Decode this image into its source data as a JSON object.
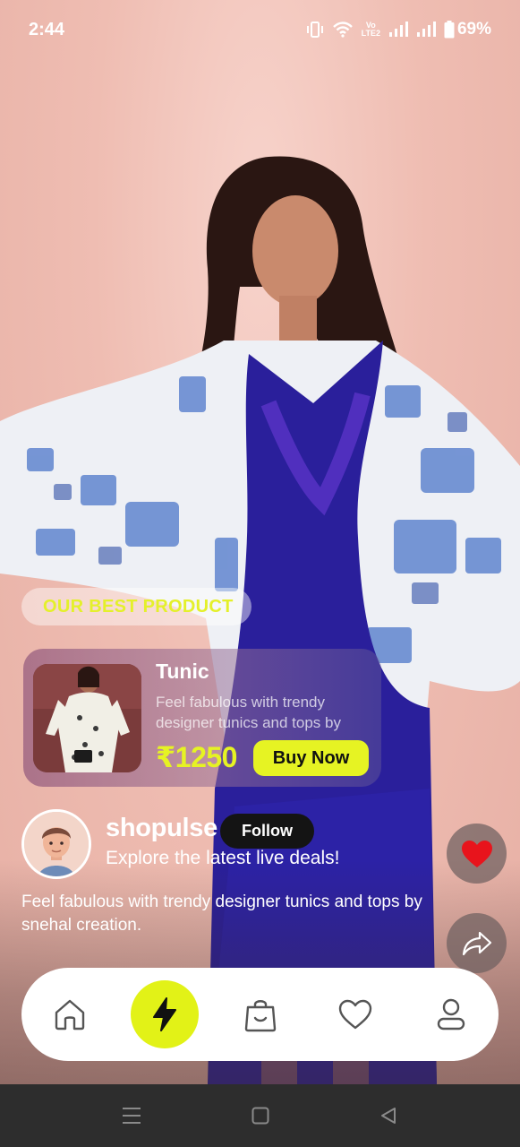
{
  "status_bar": {
    "time": "2:44",
    "volte_top": "Vo",
    "volte_bottom": "LTE2",
    "battery": "69%"
  },
  "promo": {
    "label": "OUR BEST PRODUCT"
  },
  "product": {
    "name": "Tunic",
    "description": "Feel fabulous with trendy designer tunics and tops by",
    "price": "₹1250",
    "buy_label": "Buy Now"
  },
  "seller": {
    "name": "shopulse",
    "follow_label": "Follow",
    "tagline": "Explore the latest live deals!"
  },
  "caption": "Feel fabulous with trendy designer tunics and tops by snehal creation.",
  "actions": {
    "like_icon": "heart-icon",
    "share_icon": "share-icon"
  },
  "bottom_nav": {
    "items": [
      {
        "icon": "home-icon",
        "active": false
      },
      {
        "icon": "lightning-icon",
        "active": true
      },
      {
        "icon": "shopping-bag-icon",
        "active": false
      },
      {
        "icon": "heart-outline-icon",
        "active": false
      },
      {
        "icon": "profile-icon",
        "active": false
      }
    ]
  },
  "colors": {
    "accent": "#e6f323",
    "like": "#e8141c",
    "follow_bg": "#141414",
    "nav_bg": "#ffffff"
  }
}
